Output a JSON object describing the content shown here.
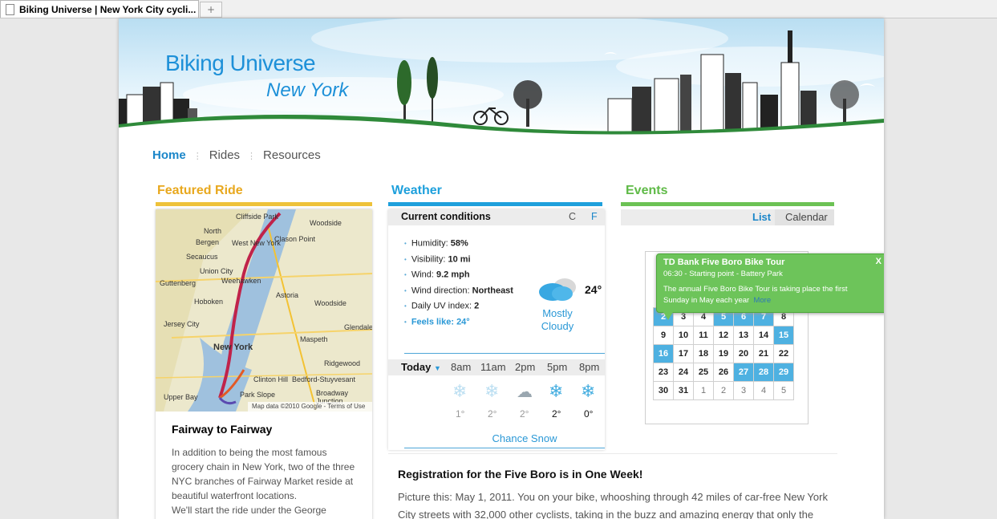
{
  "browser": {
    "tab_title": "Biking Universe | New York City cycli...",
    "new_tab_label": "+"
  },
  "site": {
    "title": "Biking Universe",
    "city": "New York"
  },
  "nav": {
    "items": [
      "Home",
      "Rides",
      "Resources"
    ],
    "active": "Home"
  },
  "colors": {
    "accent_blue": "#1b86c9",
    "featured": "#e8b322",
    "weather": "#1ea0dc",
    "events": "#5fba47"
  },
  "featured": {
    "heading": "Featured Ride",
    "map_labels": [
      "Cliffside Park",
      "North Bergen",
      "Secaucus",
      "Union City",
      "Weehawken",
      "Hoboken",
      "Jersey City",
      "New York",
      "West New York",
      "Woodside",
      "Astoria",
      "Clason Point",
      "Maspeth",
      "Ridgewood",
      "Clinton Hill",
      "Bedford-Stuyvesant",
      "Broadway Junction",
      "Park Slope",
      "Upper Bay",
      "Glendale",
      "Guttenberg",
      "Woodside"
    ],
    "map_credit": "Map data ©2010 Google - Terms of Use",
    "ride_title": "Fairway to Fairway",
    "ride_text": "In addition to being the most famous grocery chain in New York, two of the three NYC branches of Fairway Market reside at beautiful waterfront locations.",
    "ride_text2": "We'll start the ride under the George"
  },
  "weather": {
    "heading": "Weather",
    "current_label": "Current conditions",
    "unit_c": "C",
    "unit_f": "F",
    "details": [
      {
        "label": "Humidity: ",
        "value": "58%"
      },
      {
        "label": "Visibility: ",
        "value": "10 mi"
      },
      {
        "label": "Wind: ",
        "value": "9.2 mph"
      },
      {
        "label": "Wind direction: ",
        "value": "Northeast"
      },
      {
        "label": "Daily UV index: ",
        "value": "2"
      }
    ],
    "feels_like": "Feels like: 24°",
    "temp": "24°",
    "condition": "Mostly Cloudy",
    "forecast_day": "Today",
    "forecast": [
      {
        "time": "8am",
        "temp": "1°",
        "icon": "snowflake-icon"
      },
      {
        "time": "11am",
        "temp": "2°",
        "icon": "snowflake-icon"
      },
      {
        "time": "2pm",
        "temp": "2°",
        "icon": "cloud-snow-icon"
      },
      {
        "time": "5pm",
        "temp": "2°",
        "icon": "snowflake-icon"
      },
      {
        "time": "8pm",
        "temp": "0°",
        "icon": "snowflake-icon"
      }
    ],
    "outlook": "Chance Snow"
  },
  "events": {
    "heading": "Events",
    "tab_list": "List",
    "tab_calendar": "Calendar",
    "popup": {
      "title": "TD Bank Five Boro Bike Tour",
      "time": "06:30 - Starting point - Battery Park",
      "description": "The annual Five Boro Bike Tour is taking place the first Sunday in May each year",
      "more": "More",
      "close": "X"
    },
    "calendar_rows": [
      [
        {
          "d": "2",
          "hl": true
        },
        {
          "d": "3"
        },
        {
          "d": "4"
        },
        {
          "d": "5",
          "hl": true
        },
        {
          "d": "6",
          "hl": true
        },
        {
          "d": "7",
          "hl": true
        },
        {
          "d": "8"
        }
      ],
      [
        {
          "d": "9"
        },
        {
          "d": "10"
        },
        {
          "d": "11"
        },
        {
          "d": "12"
        },
        {
          "d": "13"
        },
        {
          "d": "14"
        },
        {
          "d": "15",
          "hl": true
        }
      ],
      [
        {
          "d": "16",
          "hl": true
        },
        {
          "d": "17"
        },
        {
          "d": "18"
        },
        {
          "d": "19"
        },
        {
          "d": "20"
        },
        {
          "d": "21"
        },
        {
          "d": "22"
        }
      ],
      [
        {
          "d": "23"
        },
        {
          "d": "24"
        },
        {
          "d": "25"
        },
        {
          "d": "26"
        },
        {
          "d": "27",
          "hl": true
        },
        {
          "d": "28",
          "hl": true
        },
        {
          "d": "29",
          "hl": true
        }
      ],
      [
        {
          "d": "30"
        },
        {
          "d": "31"
        },
        {
          "d": "1",
          "next": true
        },
        {
          "d": "2",
          "next": true
        },
        {
          "d": "3",
          "next": true
        },
        {
          "d": "4",
          "next": true
        },
        {
          "d": "5",
          "next": true
        }
      ]
    ]
  },
  "article": {
    "title": "Registration for the Five Boro is in One Week!",
    "body": "Picture this: May 1, 2011. You on your bike, whooshing through 42 miles of car-free New York City streets with 32,000 other cyclists, taking in the buzz and amazing energy that only the"
  }
}
